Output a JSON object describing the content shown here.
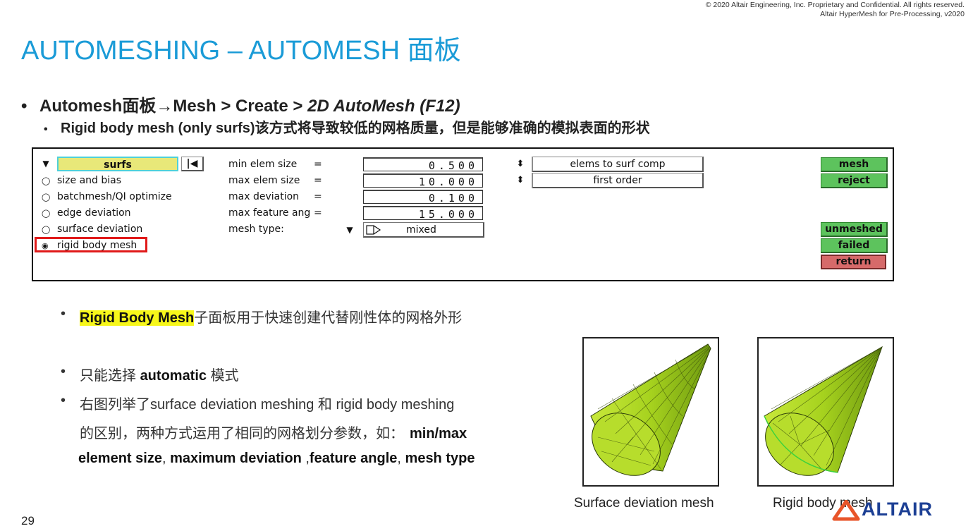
{
  "copyright": {
    "line1": "© 2020 Altair Engineering, Inc. Proprietary and Confidential. All rights reserved.",
    "line2": "Altair HyperMesh for Pre-Processing, v2020"
  },
  "title": "AUTOMESHING – AUTOMESH 面板",
  "bullet1": {
    "prefix": "Automesh面板",
    "arrow": "→",
    "text": "Mesh > Create > ",
    "italic": "2D AutoMesh (F12)"
  },
  "bullet2": "Rigid body mesh (only surfs)该方式将导致较低的网格质量，但是能够准确的模拟表面的形状",
  "panel": {
    "entity_selector": "surfs",
    "reverse_icon": "|◀",
    "radios": [
      {
        "label": "size and bias",
        "selected": false
      },
      {
        "label": "batchmesh/QI optimize",
        "selected": false
      },
      {
        "label": "edge deviation",
        "selected": false
      },
      {
        "label": "surface deviation",
        "selected": false
      },
      {
        "label": "rigid body mesh",
        "selected": true
      }
    ],
    "fields": [
      {
        "label": "min elem size",
        "eq": "=",
        "value": "0.500"
      },
      {
        "label": "max elem size",
        "eq": "=",
        "value": "10.000"
      },
      {
        "label": "max deviation",
        "eq": "=",
        "value": "0.100"
      },
      {
        "label": "max feature ang",
        "eq": "=",
        "value": "15.000"
      }
    ],
    "mesh_type_label": "mesh type:",
    "mesh_type_value": "mixed",
    "option1": "elems to surf comp",
    "option2": "first order",
    "buttons": {
      "mesh": "mesh",
      "reject": "reject",
      "unmeshed": "unmeshed",
      "failed": "failed",
      "return": "return"
    }
  },
  "sub_bullets": {
    "b1_highlight": "Rigid Body Mesh",
    "b1_rest": "子面板用于快速创建代替刚性体的网格外形",
    "b2_pre": "只能选择 ",
    "b2_bold": "automatic",
    "b2_post": " 模式",
    "b3_line1": "右图列举了surface deviation meshing 和 rigid body meshing",
    "b3_line2_pre": "的区别，两种方式运用了相同的网格划分参数，如：",
    "b3_line2_bold": "min/max",
    "b3_line3_a": "element size",
    "b3_line3_b": ", ",
    "b3_line3_c": "maximum deviation",
    "b3_line3_d": " ,",
    "b3_line3_e": "feature angle",
    "b3_line3_f": ", ",
    "b3_line3_g": "mesh type"
  },
  "images": {
    "left_caption": "Surface deviation mesh",
    "right_caption": "Rigid body mesh"
  },
  "page_number": "29",
  "logo_text": "ALTAIR",
  "colors": {
    "title_blue": "#1a9bd7",
    "mesh_green": "#9fcf1f",
    "button_green": "#5dc35d",
    "button_red": "#d66a6a",
    "highlight_red": "#e01a1a"
  }
}
